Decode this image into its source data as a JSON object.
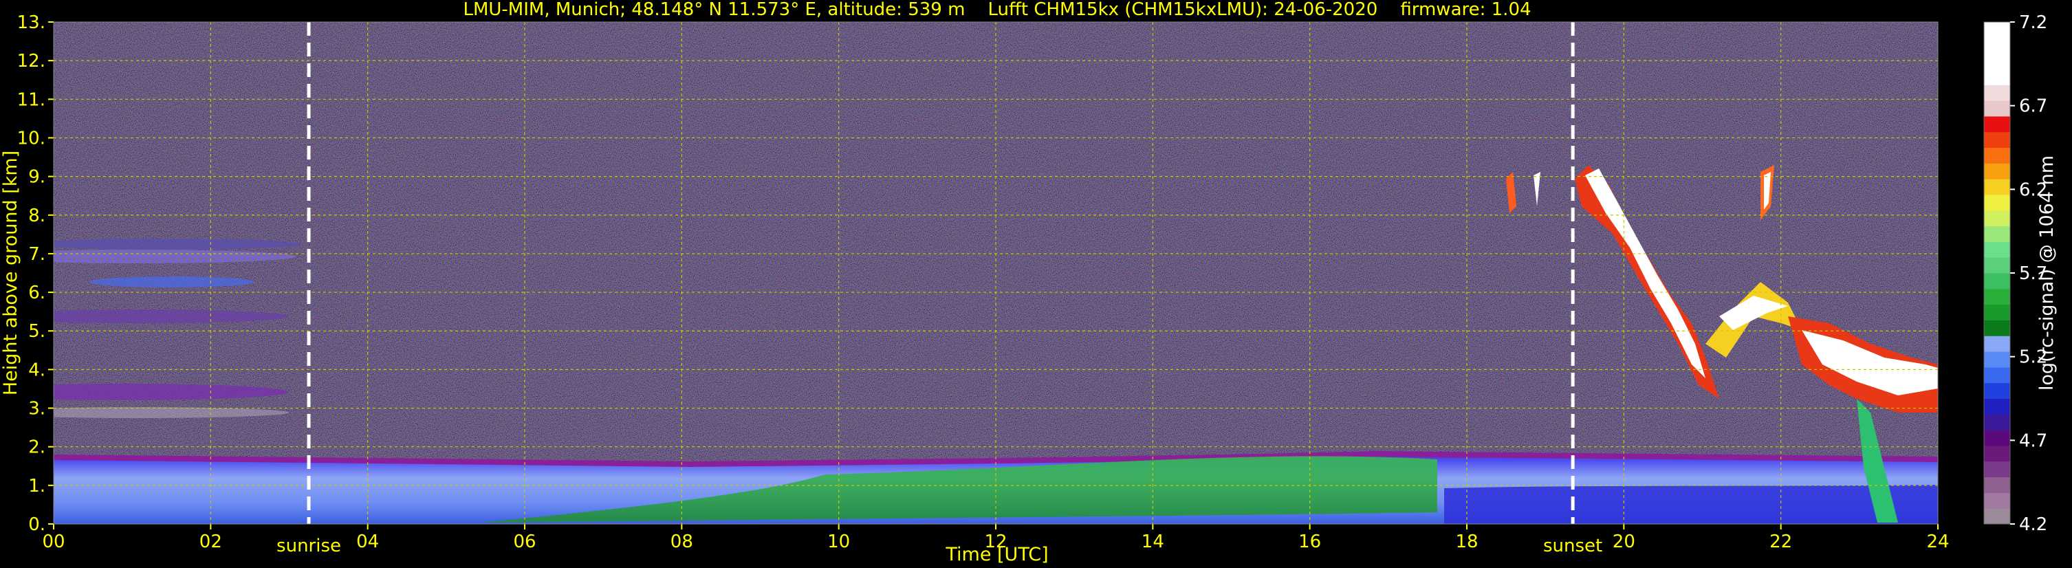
{
  "chart_data": {
    "type": "heatmap",
    "title": "LMU-MIM, Munich; 48.148° N 11.573° E, altitude: 539 m    Lufft CHM15kx (CHM15kxLMU): 24-06-2020    firmware: 1.04",
    "xlabel": "Time [UTC]",
    "ylabel": "Height above ground [km]",
    "xlim": [
      0,
      24
    ],
    "ylim": [
      0,
      13
    ],
    "x_ticks": [
      "00",
      "02",
      "04",
      "06",
      "08",
      "10",
      "12",
      "14",
      "16",
      "18",
      "20",
      "22",
      "24"
    ],
    "y_ticks": [
      "0.",
      "1.",
      "2.",
      "3.",
      "4.",
      "5.",
      "6.",
      "7.",
      "8.",
      "9.",
      "10.",
      "11.",
      "12.",
      "13."
    ],
    "grid": true,
    "markers": [
      {
        "label": "sunrise",
        "time": 3.25
      },
      {
        "label": "sunset",
        "time": 19.35
      }
    ],
    "colorbar": {
      "label": "log(rc-signal) @ 1064 nm",
      "min": 4.2,
      "max": 7.2,
      "ticks": [
        "7.2",
        "6.7",
        "6.2",
        "5.7",
        "5.2",
        "4.7",
        "4.2"
      ]
    },
    "features": [
      {
        "name": "boundary layer",
        "time_range": [
          0,
          24
        ],
        "top_km": 1.7
      },
      {
        "name": "aerosol layers",
        "time_range": [
          0,
          3.1
        ],
        "height_km": [
          3.0,
          7.6
        ]
      },
      {
        "name": "cirrus clouds",
        "time_range": [
          18.5,
          21.7
        ],
        "height_km": [
          3.0,
          9.3
        ]
      },
      {
        "name": "mid-level clouds",
        "time_range": [
          21.7,
          24
        ],
        "height_km": [
          3.2,
          5.6
        ]
      }
    ]
  }
}
